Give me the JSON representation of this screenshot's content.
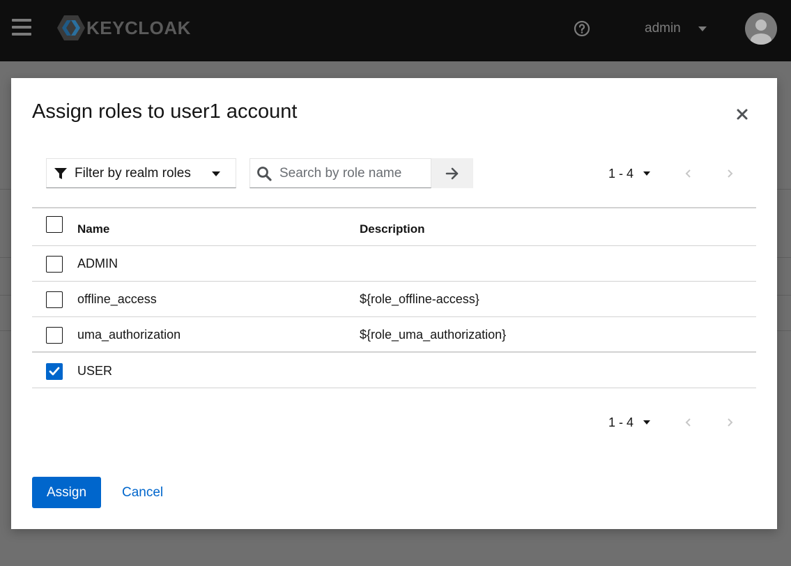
{
  "header": {
    "logo_text": "KEYCLOAK",
    "username": "admin",
    "icons": {
      "menu": "hamburger-icon",
      "help": "help-circle-icon",
      "avatar": "user-avatar-icon"
    }
  },
  "modal": {
    "title": "Assign roles to user1 account",
    "close_icon": "close-icon",
    "filter": {
      "label": "Filter by realm roles",
      "icon": "filter-icon"
    },
    "search": {
      "placeholder": "Search by role name",
      "value": "",
      "icon": "search-icon",
      "go_icon": "arrow-right-icon"
    },
    "pagination_top": {
      "range": "1 - 4",
      "prev_icon": "angle-left-icon",
      "next_icon": "angle-right-icon"
    },
    "table": {
      "columns": [
        "Name",
        "Description"
      ],
      "rows": [
        {
          "name": "ADMIN",
          "description": "",
          "checked": false
        },
        {
          "name": "offline_access",
          "description": "${role_offline-access}",
          "checked": false
        },
        {
          "name": "uma_authorization",
          "description": "${role_uma_authorization}",
          "checked": false
        },
        {
          "name": "USER",
          "description": "",
          "checked": true
        }
      ]
    },
    "pagination_bottom": {
      "range": "1 - 4"
    },
    "actions": {
      "assign": "Assign",
      "cancel": "Cancel"
    }
  },
  "colors": {
    "primary": "#0066cc",
    "header_bg": "#0e0e0e",
    "backdrop": "#6f6f6f"
  }
}
